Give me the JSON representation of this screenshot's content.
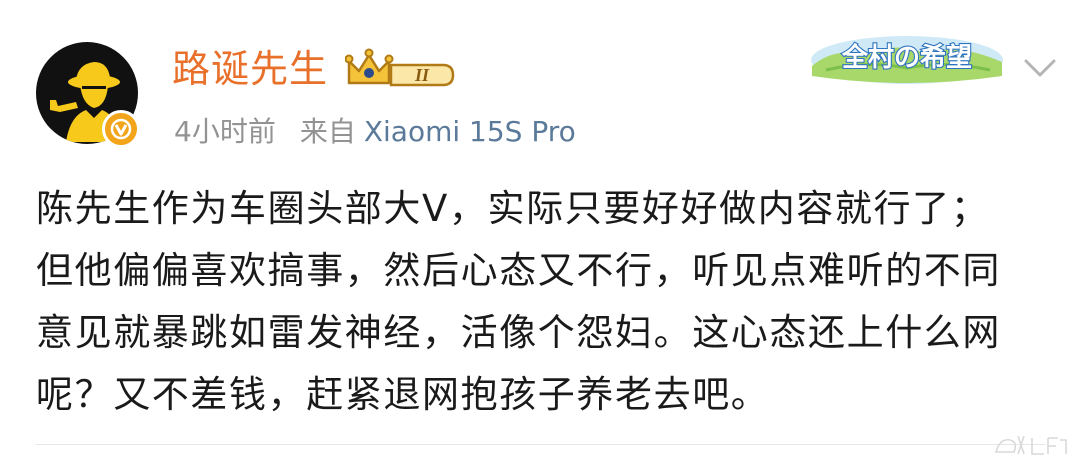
{
  "post": {
    "author": {
      "name": "路诞先生",
      "verified": true,
      "level_badge_text": "II"
    },
    "time": "4小时前",
    "source_prefix": "来自",
    "device": "Xiaomi 15S Pro",
    "banner_text": "全村の希望",
    "content_lines": [
      "陈先生作为车圈头部大V，实际只要好好做内容就行了；",
      "但他偏偏喜欢搞事，然后心态又不行，听见点难听的不同",
      "意见就暴跳如雷发神经，活像个怨妇。这心态还上什么网",
      "呢？又不差钱，赶紧退网抱孩子养老去吧。"
    ]
  },
  "icons": {
    "avatar": "detective-avatar",
    "verified": "verified-v-icon",
    "badge": "crown-badge-icon",
    "menu": "chevron-down-icon",
    "watermark": "weibo-watermark-icon"
  },
  "colors": {
    "username": "#e8702a",
    "device_link": "#5b7a99",
    "meta": "#939393",
    "text": "#1a1a1a",
    "badge_gold": "#f2a51b"
  }
}
